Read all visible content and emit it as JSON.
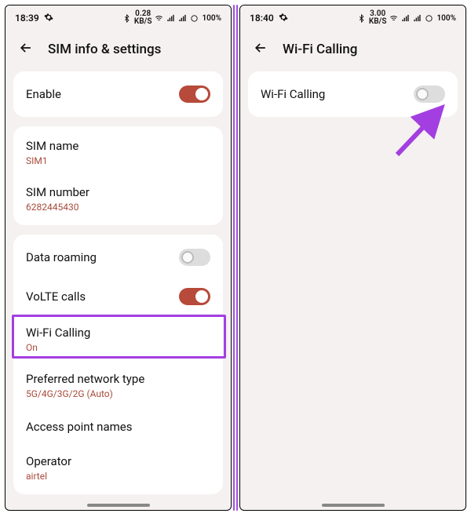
{
  "left": {
    "status": {
      "time": "18:39",
      "net": "0.28",
      "netUnit": "KB/S",
      "battery": "100%"
    },
    "title": "SIM info & settings",
    "enable": {
      "label": "Enable"
    },
    "simName": {
      "label": "SIM name",
      "value": "SIM1"
    },
    "simNumber": {
      "label": "SIM number",
      "value": "6282445430"
    },
    "roaming": {
      "label": "Data roaming"
    },
    "volte": {
      "label": "VoLTE calls"
    },
    "wifiCalling": {
      "label": "Wi-Fi Calling",
      "value": "On"
    },
    "prefNet": {
      "label": "Preferred network type",
      "value": "5G/4G/3G/2G (Auto)"
    },
    "apn": {
      "label": "Access point names"
    },
    "operator": {
      "label": "Operator",
      "value": "airtel"
    }
  },
  "right": {
    "status": {
      "time": "18:40",
      "net": "3.00",
      "netUnit": "KB/S",
      "battery": "100%"
    },
    "title": "Wi-Fi Calling",
    "toggle": {
      "label": "Wi-Fi Calling"
    }
  }
}
